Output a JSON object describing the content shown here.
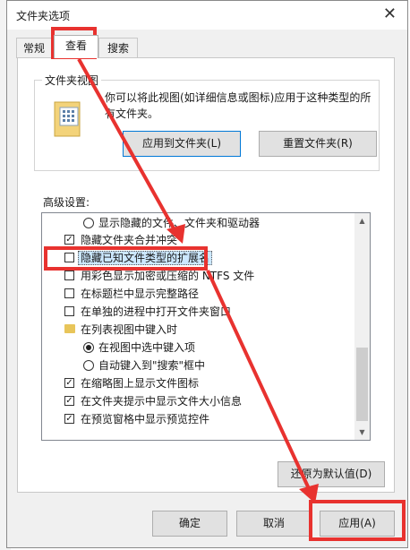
{
  "window": {
    "title": "文件夹选项",
    "close_glyph": "✕"
  },
  "tabs": [
    {
      "label": "常规"
    },
    {
      "label": "查看"
    },
    {
      "label": "搜索"
    }
  ],
  "folder_view": {
    "group_title": "文件夹视图",
    "description": "你可以将此视图(如详细信息或图标)应用于这种类型的所有文件夹。",
    "apply_button": "应用到文件夹(L)",
    "reset_button": "重置文件夹(R)"
  },
  "advanced": {
    "label": "高级设置:",
    "items": [
      {
        "type": "radio",
        "checked": false,
        "label": "显示隐藏的文件、文件夹和驱动器"
      },
      {
        "type": "checkbox",
        "checked": true,
        "label": "隐藏文件夹合并冲突"
      },
      {
        "type": "checkbox",
        "checked": false,
        "label": "隐藏已知文件类型的扩展名"
      },
      {
        "type": "checkbox",
        "checked": false,
        "label": "用彩色显示加密或压缩的 NTFS 文件"
      },
      {
        "type": "checkbox",
        "checked": false,
        "label": "在标题栏中显示完整路径"
      },
      {
        "type": "checkbox",
        "checked": false,
        "label": "在单独的进程中打开文件夹窗口"
      },
      {
        "type": "folder",
        "label": "在列表视图中键入时"
      },
      {
        "type": "radio",
        "checked": true,
        "label": "在视图中选中键入项"
      },
      {
        "type": "radio",
        "checked": false,
        "label": "自动键入到\"搜索\"框中"
      },
      {
        "type": "checkbox",
        "checked": true,
        "label": "在缩略图上显示文件图标"
      },
      {
        "type": "checkbox",
        "checked": true,
        "label": "在文件夹提示中显示文件大小信息"
      },
      {
        "type": "checkbox",
        "checked": true,
        "label": "在预览窗格中显示预览控件"
      }
    ],
    "restore_button": "还原为默认值(D)"
  },
  "footer": {
    "ok": "确定",
    "cancel": "取消",
    "apply": "应用(A)"
  },
  "annotation_color": "#e8322f"
}
